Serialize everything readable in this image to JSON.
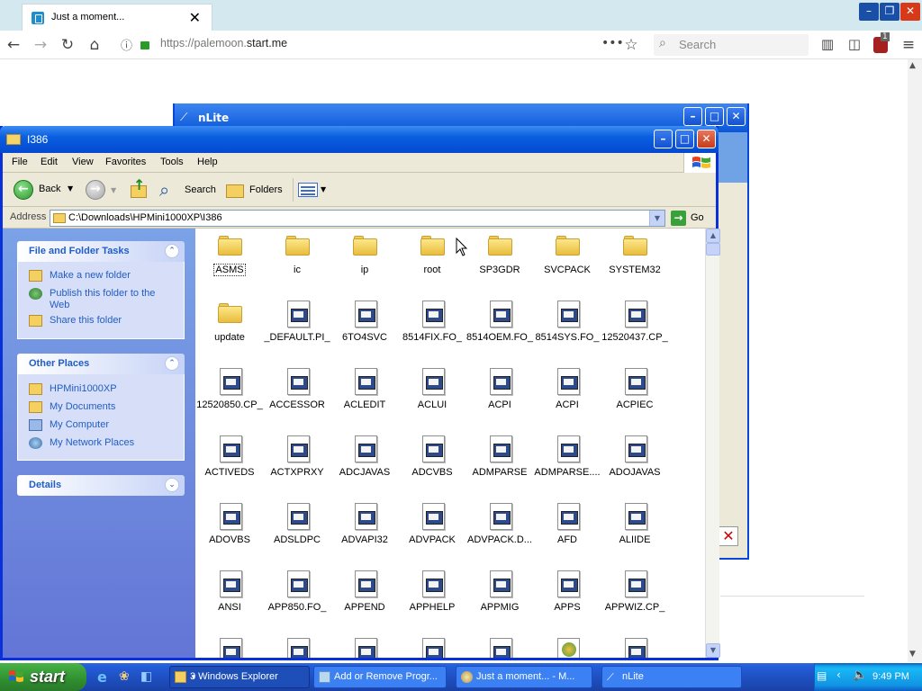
{
  "browser": {
    "tab_title": "Just a moment...",
    "url_prefix": "https://palemoon.",
    "url_domain": "start.me",
    "search_placeholder": "Search",
    "badge_count": "1"
  },
  "nlite": {
    "title": "nLite"
  },
  "explorer": {
    "title": "I386",
    "menu": [
      "File",
      "Edit",
      "View",
      "Favorites",
      "Tools",
      "Help"
    ],
    "toolbar": {
      "back": "Back",
      "search": "Search",
      "folders": "Folders"
    },
    "address_label": "Address",
    "address_value": "C:\\Downloads\\HPMini1000XP\\I386",
    "go_label": "Go",
    "tasks": {
      "file_folder_title": "File and Folder Tasks",
      "file_folder_items": [
        "Make a new folder",
        "Publish this folder to the Web",
        "Share this folder"
      ],
      "other_places_title": "Other Places",
      "other_places_items": [
        "HPMini1000XP",
        "My Documents",
        "My Computer",
        "My Network Places"
      ],
      "details_title": "Details"
    },
    "files": [
      {
        "name": "ASMS",
        "type": "folder"
      },
      {
        "name": "ic",
        "type": "folder"
      },
      {
        "name": "ip",
        "type": "folder"
      },
      {
        "name": "root",
        "type": "folder"
      },
      {
        "name": "SP3GDR",
        "type": "folder"
      },
      {
        "name": "SVCPACK",
        "type": "folder"
      },
      {
        "name": "SYSTEM32",
        "type": "folder"
      },
      {
        "name": "update",
        "type": "folder"
      },
      {
        "name": "_DEFAULT.PI_",
        "type": "file"
      },
      {
        "name": "6TO4SVC",
        "type": "file"
      },
      {
        "name": "8514FIX.FO_",
        "type": "file"
      },
      {
        "name": "8514OEM.FO_",
        "type": "file"
      },
      {
        "name": "8514SYS.FO_",
        "type": "file"
      },
      {
        "name": "12520437.CP_",
        "type": "file"
      },
      {
        "name": "12520850.CP_",
        "type": "file"
      },
      {
        "name": "ACCESSOR",
        "type": "file"
      },
      {
        "name": "ACLEDIT",
        "type": "file"
      },
      {
        "name": "ACLUI",
        "type": "file"
      },
      {
        "name": "ACPI",
        "type": "file"
      },
      {
        "name": "ACPI",
        "type": "file"
      },
      {
        "name": "ACPIEC",
        "type": "file"
      },
      {
        "name": "ACTIVEDS",
        "type": "file"
      },
      {
        "name": "ACTXPRXY",
        "type": "file"
      },
      {
        "name": "ADCJAVAS",
        "type": "file"
      },
      {
        "name": "ADCVBS",
        "type": "file"
      },
      {
        "name": "ADMPARSE",
        "type": "file"
      },
      {
        "name": "ADMPARSE....",
        "type": "file"
      },
      {
        "name": "ADOJAVAS",
        "type": "file"
      },
      {
        "name": "ADOVBS",
        "type": "file"
      },
      {
        "name": "ADSLDPC",
        "type": "file"
      },
      {
        "name": "ADVAPI32",
        "type": "file"
      },
      {
        "name": "ADVPACK",
        "type": "file"
      },
      {
        "name": "ADVPACK.D...",
        "type": "file"
      },
      {
        "name": "AFD",
        "type": "file"
      },
      {
        "name": "ALIIDE",
        "type": "file"
      },
      {
        "name": "ANSI",
        "type": "file"
      },
      {
        "name": "APP850.FO_",
        "type": "file"
      },
      {
        "name": "APPEND",
        "type": "file"
      },
      {
        "name": "APPHELP",
        "type": "file"
      },
      {
        "name": "APPMIG",
        "type": "file"
      },
      {
        "name": "APPS",
        "type": "file"
      },
      {
        "name": "APPWIZ.CP_",
        "type": "file"
      },
      {
        "name": "",
        "type": "file"
      },
      {
        "name": "",
        "type": "file"
      },
      {
        "name": "",
        "type": "file"
      },
      {
        "name": "",
        "type": "file"
      },
      {
        "name": "",
        "type": "file"
      },
      {
        "name": "",
        "type": "setup"
      },
      {
        "name": "",
        "type": "file"
      }
    ]
  },
  "taskbar": {
    "start_label": "start",
    "tasks": [
      "3 Windows Explorer",
      "Add or Remove Progr...",
      "Just a moment... - M...",
      "nLite"
    ],
    "clock": "9:49 PM"
  }
}
